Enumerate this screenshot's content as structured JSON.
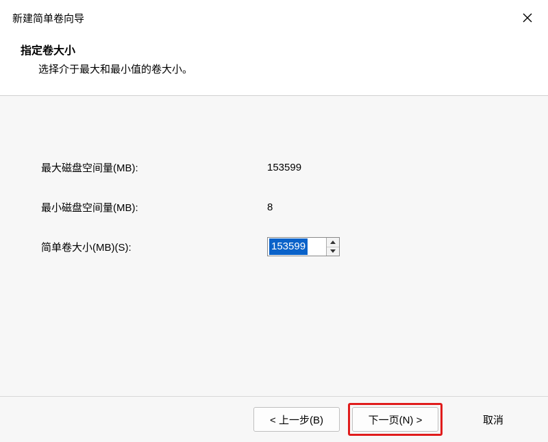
{
  "window": {
    "title": "新建简单卷向导"
  },
  "header": {
    "title": "指定卷大小",
    "subtitle": "选择介于最大和最小值的卷大小。"
  },
  "fields": {
    "max_label": "最大磁盘空间量(MB):",
    "max_value": "153599",
    "min_label": "最小磁盘空间量(MB):",
    "min_value": "8",
    "size_label": "简单卷大小(MB)(S):",
    "size_value": "153599"
  },
  "footer": {
    "back": "< 上一步(B)",
    "next": "下一页(N) >",
    "cancel": "取消"
  }
}
